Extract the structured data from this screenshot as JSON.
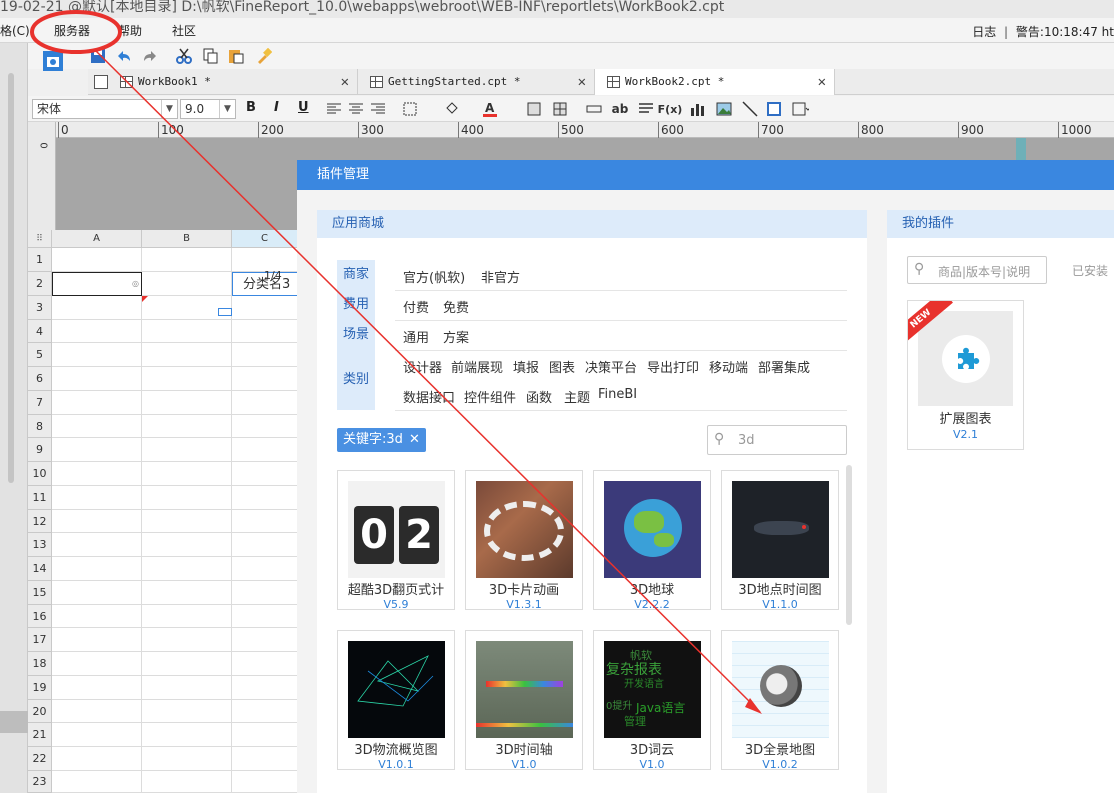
{
  "titlebar": {
    "text": "19-02-21 @默认[本地目录]   D:\\帆软\\FineReport_10.0\\webapps\\webroot\\WEB-INF\\reportlets\\WorkBook2.cpt"
  },
  "menubar": {
    "items": [
      {
        "label": "格(C)"
      },
      {
        "label": "服务器"
      },
      {
        "label": "帮助"
      },
      {
        "label": "社区"
      }
    ],
    "right_log": "日志",
    "right_warn": "警告:10:18:47 ht"
  },
  "tabs": [
    {
      "label": "WorkBook1 *"
    },
    {
      "label": "GettingStarted.cpt *"
    },
    {
      "label": "WorkBook2.cpt *"
    }
  ],
  "format_toolbar": {
    "font": "宋体",
    "size": "9.0",
    "bold": "B",
    "italic": "I",
    "underline": "U"
  },
  "ruler": {
    "zero": "0",
    "ticks": [
      "0",
      "100",
      "200",
      "300",
      "400",
      "500",
      "600",
      "700",
      "800",
      "900",
      "1000"
    ]
  },
  "sheet": {
    "corner": "⠿",
    "columns": [
      "A",
      "B",
      "C"
    ],
    "rows": [
      "1",
      "2",
      "3",
      "4",
      "5",
      "6",
      "7",
      "8",
      "9",
      "10",
      "11",
      "12",
      "13",
      "14",
      "15",
      "16",
      "17",
      "18",
      "19",
      "20",
      "21",
      "22",
      "23"
    ],
    "cell_c2": "分类名3",
    "cell_c2_overlay": "1/4"
  },
  "dialog": {
    "title": "插件管理",
    "store": {
      "header": "应用商城",
      "filters": [
        {
          "label": "商家",
          "options": [
            "官方(帆软)",
            "非官方"
          ]
        },
        {
          "label": "费用",
          "options": [
            "付费",
            "免费"
          ]
        },
        {
          "label": "场景",
          "options": [
            "通用",
            "方案"
          ]
        },
        {
          "label": "类别",
          "options": [
            "设计器",
            "前端展现",
            "填报",
            "图表",
            "决策平台",
            "导出打印",
            "移动端",
            "部署集成"
          ],
          "options2": [
            "数据接口",
            "控件组件",
            "函数",
            "主题",
            "FineBI"
          ]
        }
      ],
      "keyword_chip": "关键字:3d",
      "search_value": "3d",
      "cards": [
        {
          "name": "超酷3D翻页式计",
          "version": "V5.9",
          "digits": [
            "0",
            "2"
          ]
        },
        {
          "name": "3D卡片动画",
          "version": "V1.3.1"
        },
        {
          "name": "3D地球",
          "version": "V2.2.2"
        },
        {
          "name": "3D地点时间图",
          "version": "V1.1.0"
        },
        {
          "name": "3D物流概览图",
          "version": "V1.0.1"
        },
        {
          "name": "3D时间轴",
          "version": "V1.0"
        },
        {
          "name": "3D词云",
          "version": "V1.0",
          "cloud_words": [
            "帆软",
            "复杂报表",
            "开发语言",
            "Java语言",
            "管理",
            "0提升"
          ]
        },
        {
          "name": "3D全景地图",
          "version": "V1.0.2"
        }
      ]
    },
    "my_plugins": {
      "header": "我的插件",
      "search_placeholder": "商品|版本号|说明",
      "installed_label": "已安装",
      "new_badge": "NEW",
      "plugin": {
        "name": "扩展图表",
        "version": "V2.1"
      }
    }
  },
  "colors": {
    "accent": "#3a87e0",
    "link": "#2f7fd6",
    "annotation": "#e8322d"
  }
}
